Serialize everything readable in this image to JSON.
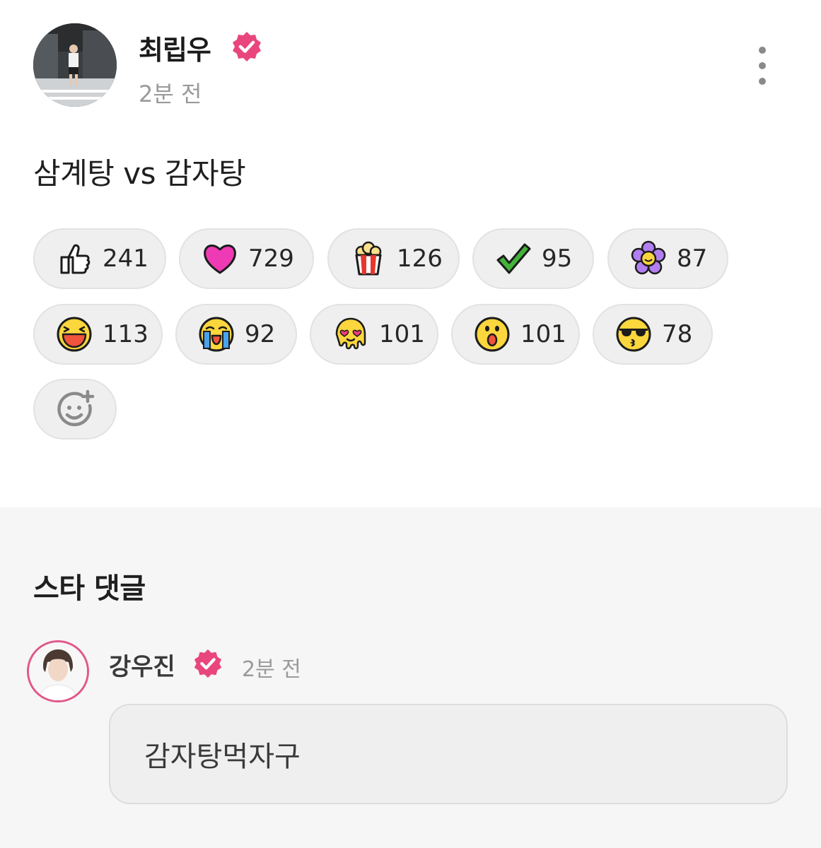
{
  "post": {
    "author": "최립우",
    "time": "2분 전",
    "text": "삼계탕 vs 감자탕",
    "more_icon": "more-vertical-icon",
    "verified_icon": "verified-badge-icon"
  },
  "reactions": [
    {
      "icon": "thumbs-up-icon",
      "count": "241"
    },
    {
      "icon": "heart-icon",
      "count": "729"
    },
    {
      "icon": "popcorn-icon",
      "count": "126"
    },
    {
      "icon": "checkmark-icon",
      "count": "95"
    },
    {
      "icon": "flower-icon",
      "count": "87"
    },
    {
      "icon": "laughing-face-icon",
      "count": "113"
    },
    {
      "icon": "crying-face-icon",
      "count": "92"
    },
    {
      "icon": "melting-heart-eyes-icon",
      "count": "101"
    },
    {
      "icon": "surprised-face-icon",
      "count": "101"
    },
    {
      "icon": "sunglasses-kiss-icon",
      "count": "78"
    }
  ],
  "add_reaction_icon": "add-emoji-icon",
  "comments": {
    "section_title": "스타 댓글",
    "items": [
      {
        "author": "강우진",
        "time": "2분 전",
        "text": "감자탕먹자구"
      }
    ]
  },
  "colors": {
    "verified": "#e8467c",
    "pill_bg": "#efefef",
    "comment_section_bg": "#f6f6f6",
    "avatar_ring": "#e0578a"
  }
}
